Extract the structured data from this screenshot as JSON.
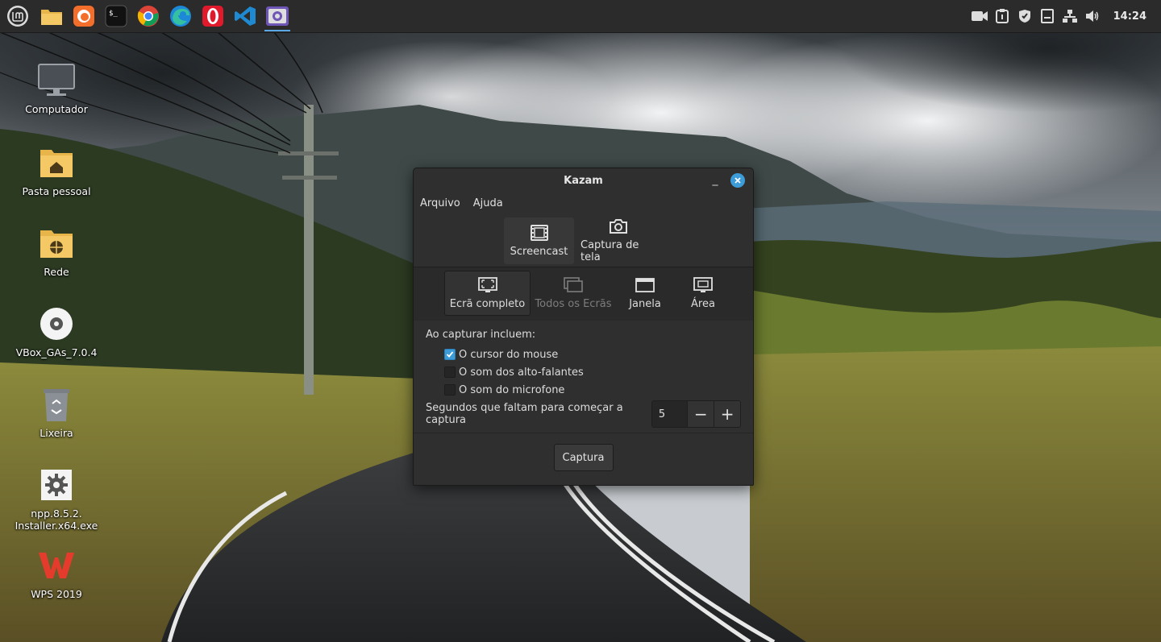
{
  "panel": {
    "menu_icon": "linux-mint-menu-icon",
    "launchers": [
      {
        "name": "files-launcher",
        "icon": "folder-icon"
      },
      {
        "name": "firefox-launcher",
        "icon": "firefox-icon"
      },
      {
        "name": "terminal-launcher",
        "icon": "terminal-icon"
      },
      {
        "name": "chrome-launcher",
        "icon": "chrome-icon"
      },
      {
        "name": "edge-launcher",
        "icon": "edge-icon"
      },
      {
        "name": "opera-launcher",
        "icon": "opera-icon"
      },
      {
        "name": "vscode-launcher",
        "icon": "vscode-icon"
      },
      {
        "name": "kazam-launcher",
        "icon": "kazam-icon",
        "active": true
      }
    ],
    "tray": [
      "video-recorder-icon",
      "clipboard-icon",
      "shield-icon",
      "notes-icon",
      "network-icon",
      "volume-icon"
    ],
    "clock": "14:24"
  },
  "desktop": {
    "icons": [
      {
        "label": "Computador",
        "icon": "monitor-icon"
      },
      {
        "label": "Pasta pessoal",
        "icon": "home-folder-icon"
      },
      {
        "label": "Rede",
        "icon": "network-folder-icon"
      },
      {
        "label": "VBox_GAs_7.0.4",
        "icon": "disc-icon"
      },
      {
        "label": "Lixeira",
        "icon": "trash-icon"
      },
      {
        "label": "npp.8.5.2.\nInstaller.x64.exe",
        "line1": "npp.8.5.2.",
        "line2": "Installer.x64.exe",
        "icon": "gear-icon"
      },
      {
        "label": "WPS 2019",
        "icon": "wps-icon"
      }
    ]
  },
  "kazam": {
    "title": "Kazam",
    "minimize": "_",
    "menu": {
      "file": "Arquivo",
      "help": "Ajuda"
    },
    "modes": {
      "screencast": "Screencast",
      "screenshot": "Captura de tela",
      "selected": "screencast"
    },
    "sources": {
      "fullscreen": "Ecrã completo",
      "all_screens": "Todos os Ecrãs",
      "window": "Janela",
      "area": "Área",
      "selected": "fullscreen"
    },
    "options": {
      "heading": "Ao capturar incluem:",
      "mouse_cursor": {
        "label": "O cursor do mouse",
        "checked": true
      },
      "speakers": {
        "label": "O som dos alto-falantes",
        "checked": false
      },
      "microphone": {
        "label": "O som do microfone",
        "checked": false
      }
    },
    "delay": {
      "label": "Segundos que faltam para começar a captura",
      "value": "5",
      "minus": "−",
      "plus": "+"
    },
    "capture_button": "Captura"
  },
  "colors": {
    "accent": "#3d9bd8",
    "panel": "#2b2b2b",
    "window": "#2f2f2f"
  }
}
